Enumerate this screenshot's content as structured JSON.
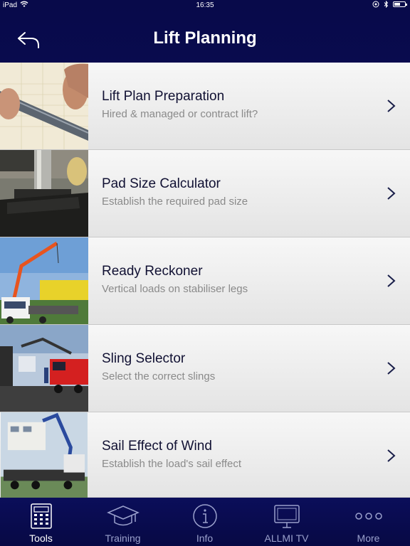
{
  "status_bar": {
    "device": "iPad",
    "time": "16:35",
    "battery_level": 0.55
  },
  "nav": {
    "title": "Lift Planning",
    "back_icon": "back-arrow-icon"
  },
  "items": [
    {
      "title": "Lift Plan Preparation",
      "subtitle": "Hired & managed or contract lift?"
    },
    {
      "title": "Pad Size Calculator",
      "subtitle": "Establish the required pad size"
    },
    {
      "title": "Ready Reckoner",
      "subtitle": "Vertical loads on stabiliser legs"
    },
    {
      "title": "Sling Selector",
      "subtitle": "Select the correct slings"
    },
    {
      "title": "Sail Effect of Wind",
      "subtitle": "Establish the load's sail effect"
    }
  ],
  "tabs": [
    {
      "label": "Tools",
      "icon": "calculator-icon",
      "active": true
    },
    {
      "label": "Training",
      "icon": "graduation-cap-icon",
      "active": false
    },
    {
      "label": "Info",
      "icon": "info-icon",
      "active": false
    },
    {
      "label": "ALLMI TV",
      "icon": "tv-icon",
      "active": false
    },
    {
      "label": "More",
      "icon": "more-icon",
      "active": false
    }
  ],
  "colors": {
    "nav_background": "#0b0e52",
    "row_title": "#111133",
    "row_subtitle": "#8a8a8a",
    "tab_inactive": "#9aa0cc"
  }
}
